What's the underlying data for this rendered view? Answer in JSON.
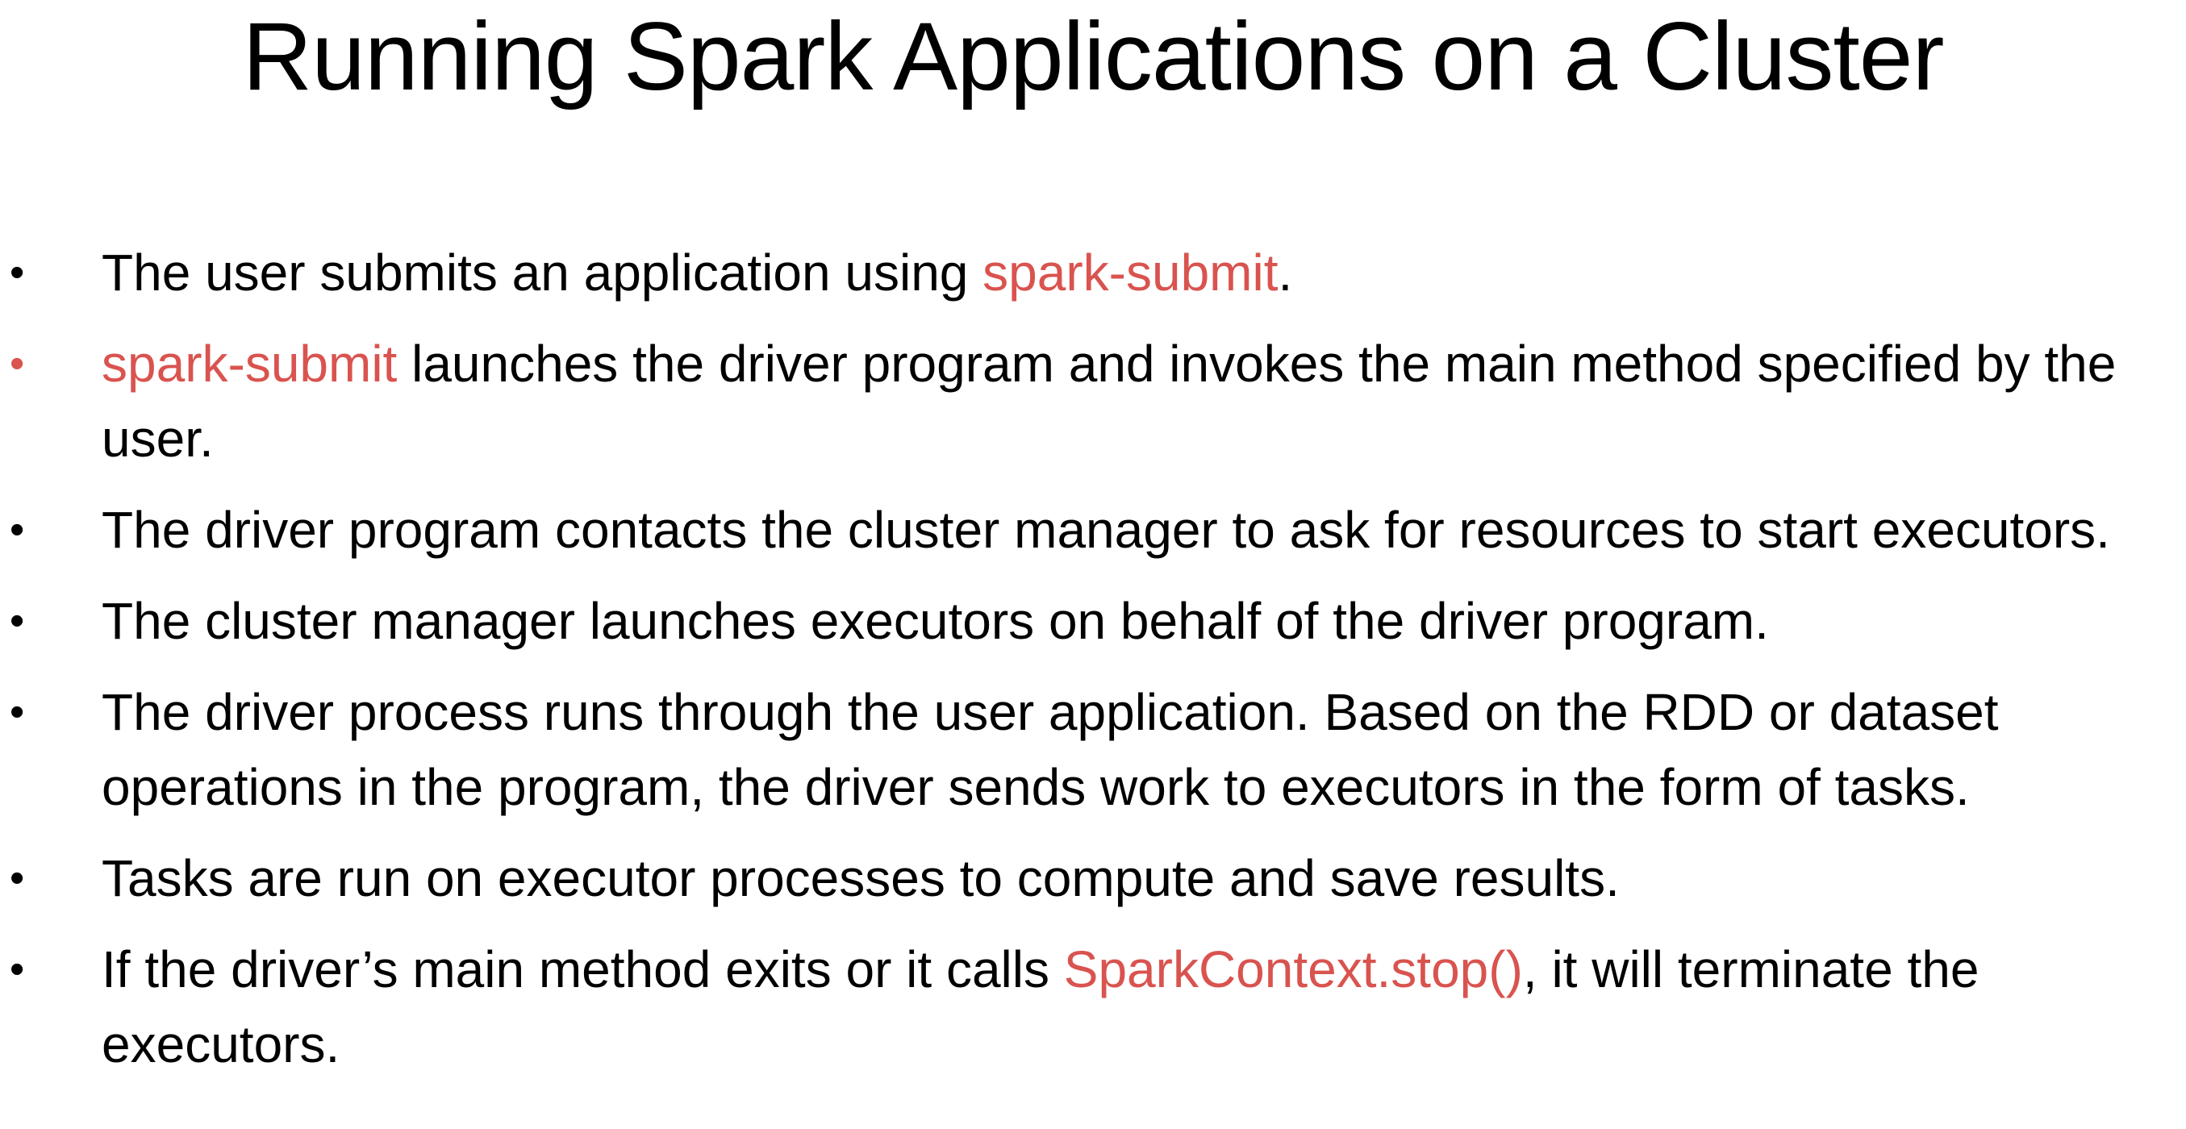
{
  "slide": {
    "title": "Running Spark Applications on a Cluster",
    "accent_color": "#d9534f",
    "bullets": [
      {
        "marker_color": "black",
        "segments": [
          {
            "text": "The user submits an application using ",
            "highlight": false
          },
          {
            "text": "spark-submit",
            "highlight": true
          },
          {
            "text": ".",
            "highlight": false
          }
        ]
      },
      {
        "marker_color": "red",
        "segments": [
          {
            "text": "spark-submit",
            "highlight": true
          },
          {
            "text": " launches the driver program and invokes the main method specified by the user.",
            "highlight": false
          }
        ]
      },
      {
        "marker_color": "black",
        "segments": [
          {
            "text": "The driver program contacts the cluster manager to ask for resources to start executors.",
            "highlight": false
          }
        ]
      },
      {
        "marker_color": "black",
        "segments": [
          {
            "text": "The cluster manager launches executors on behalf of the driver program.",
            "highlight": false
          }
        ]
      },
      {
        "marker_color": "black",
        "segments": [
          {
            "text": "The driver process runs through the user application. Based on the RDD or dataset operations in the program, the driver sends work to executors in the form of tasks.",
            "highlight": false
          }
        ]
      },
      {
        "marker_color": "black",
        "segments": [
          {
            "text": "Tasks are run on executor processes to compute and save results.",
            "highlight": false
          }
        ]
      },
      {
        "marker_color": "black",
        "segments": [
          {
            "text": "If the driver’s main method exits or it calls ",
            "highlight": false
          },
          {
            "text": "SparkContext.stop()",
            "highlight": true
          },
          {
            "text": ", it will terminate the executors.",
            "highlight": false
          }
        ]
      }
    ]
  }
}
